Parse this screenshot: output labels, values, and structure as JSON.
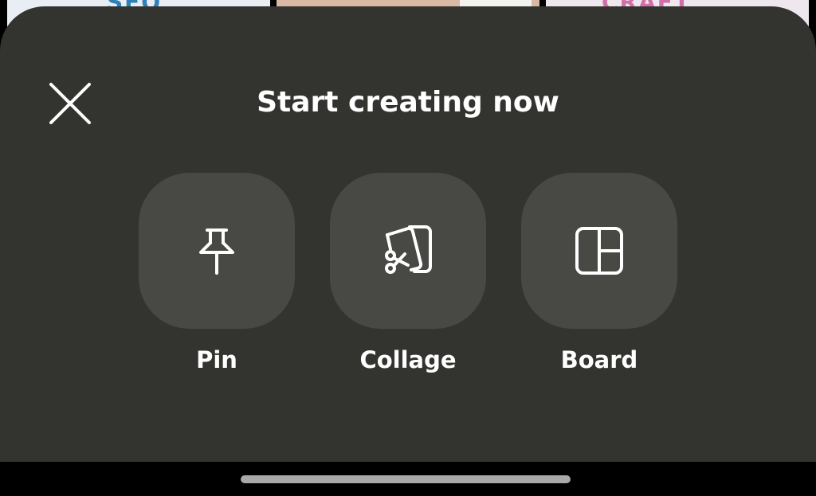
{
  "background": {
    "left_fragment": "SEO",
    "right_fragment": "CRAFT"
  },
  "sheet": {
    "title": "Start creating now",
    "close_icon": "close-icon"
  },
  "options": [
    {
      "label": "Pin",
      "icon": "pushpin-icon"
    },
    {
      "label": "Collage",
      "icon": "collage-scissors-icon"
    },
    {
      "label": "Board",
      "icon": "board-layout-icon"
    }
  ],
  "colors": {
    "sheet_background": "#33342f",
    "tile_background": "#484944",
    "text": "#ffffff",
    "home_indicator": "#a8a8a8"
  }
}
